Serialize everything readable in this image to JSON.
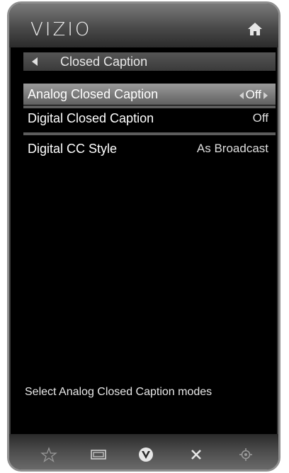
{
  "brand": "VIZIO",
  "header": {
    "home_icon": "home-icon"
  },
  "menu": {
    "title": "Closed Caption",
    "items": [
      {
        "label": "Analog Closed Caption",
        "value": "Off",
        "selected": true
      },
      {
        "label": "Digital Closed Caption",
        "value": "Off",
        "selected": false
      },
      {
        "label": "Digital CC Style",
        "value": "As Broadcast",
        "selected": false
      }
    ]
  },
  "hint": "Select Analog Closed Caption modes",
  "footer": {
    "buttons": [
      "star-icon",
      "wide-screen-icon",
      "vizio-v-icon",
      "close-icon",
      "settings-icon"
    ]
  },
  "colors": {
    "background": "#000000",
    "selected_row": "#8a8a8a",
    "text": "#ffffff"
  }
}
